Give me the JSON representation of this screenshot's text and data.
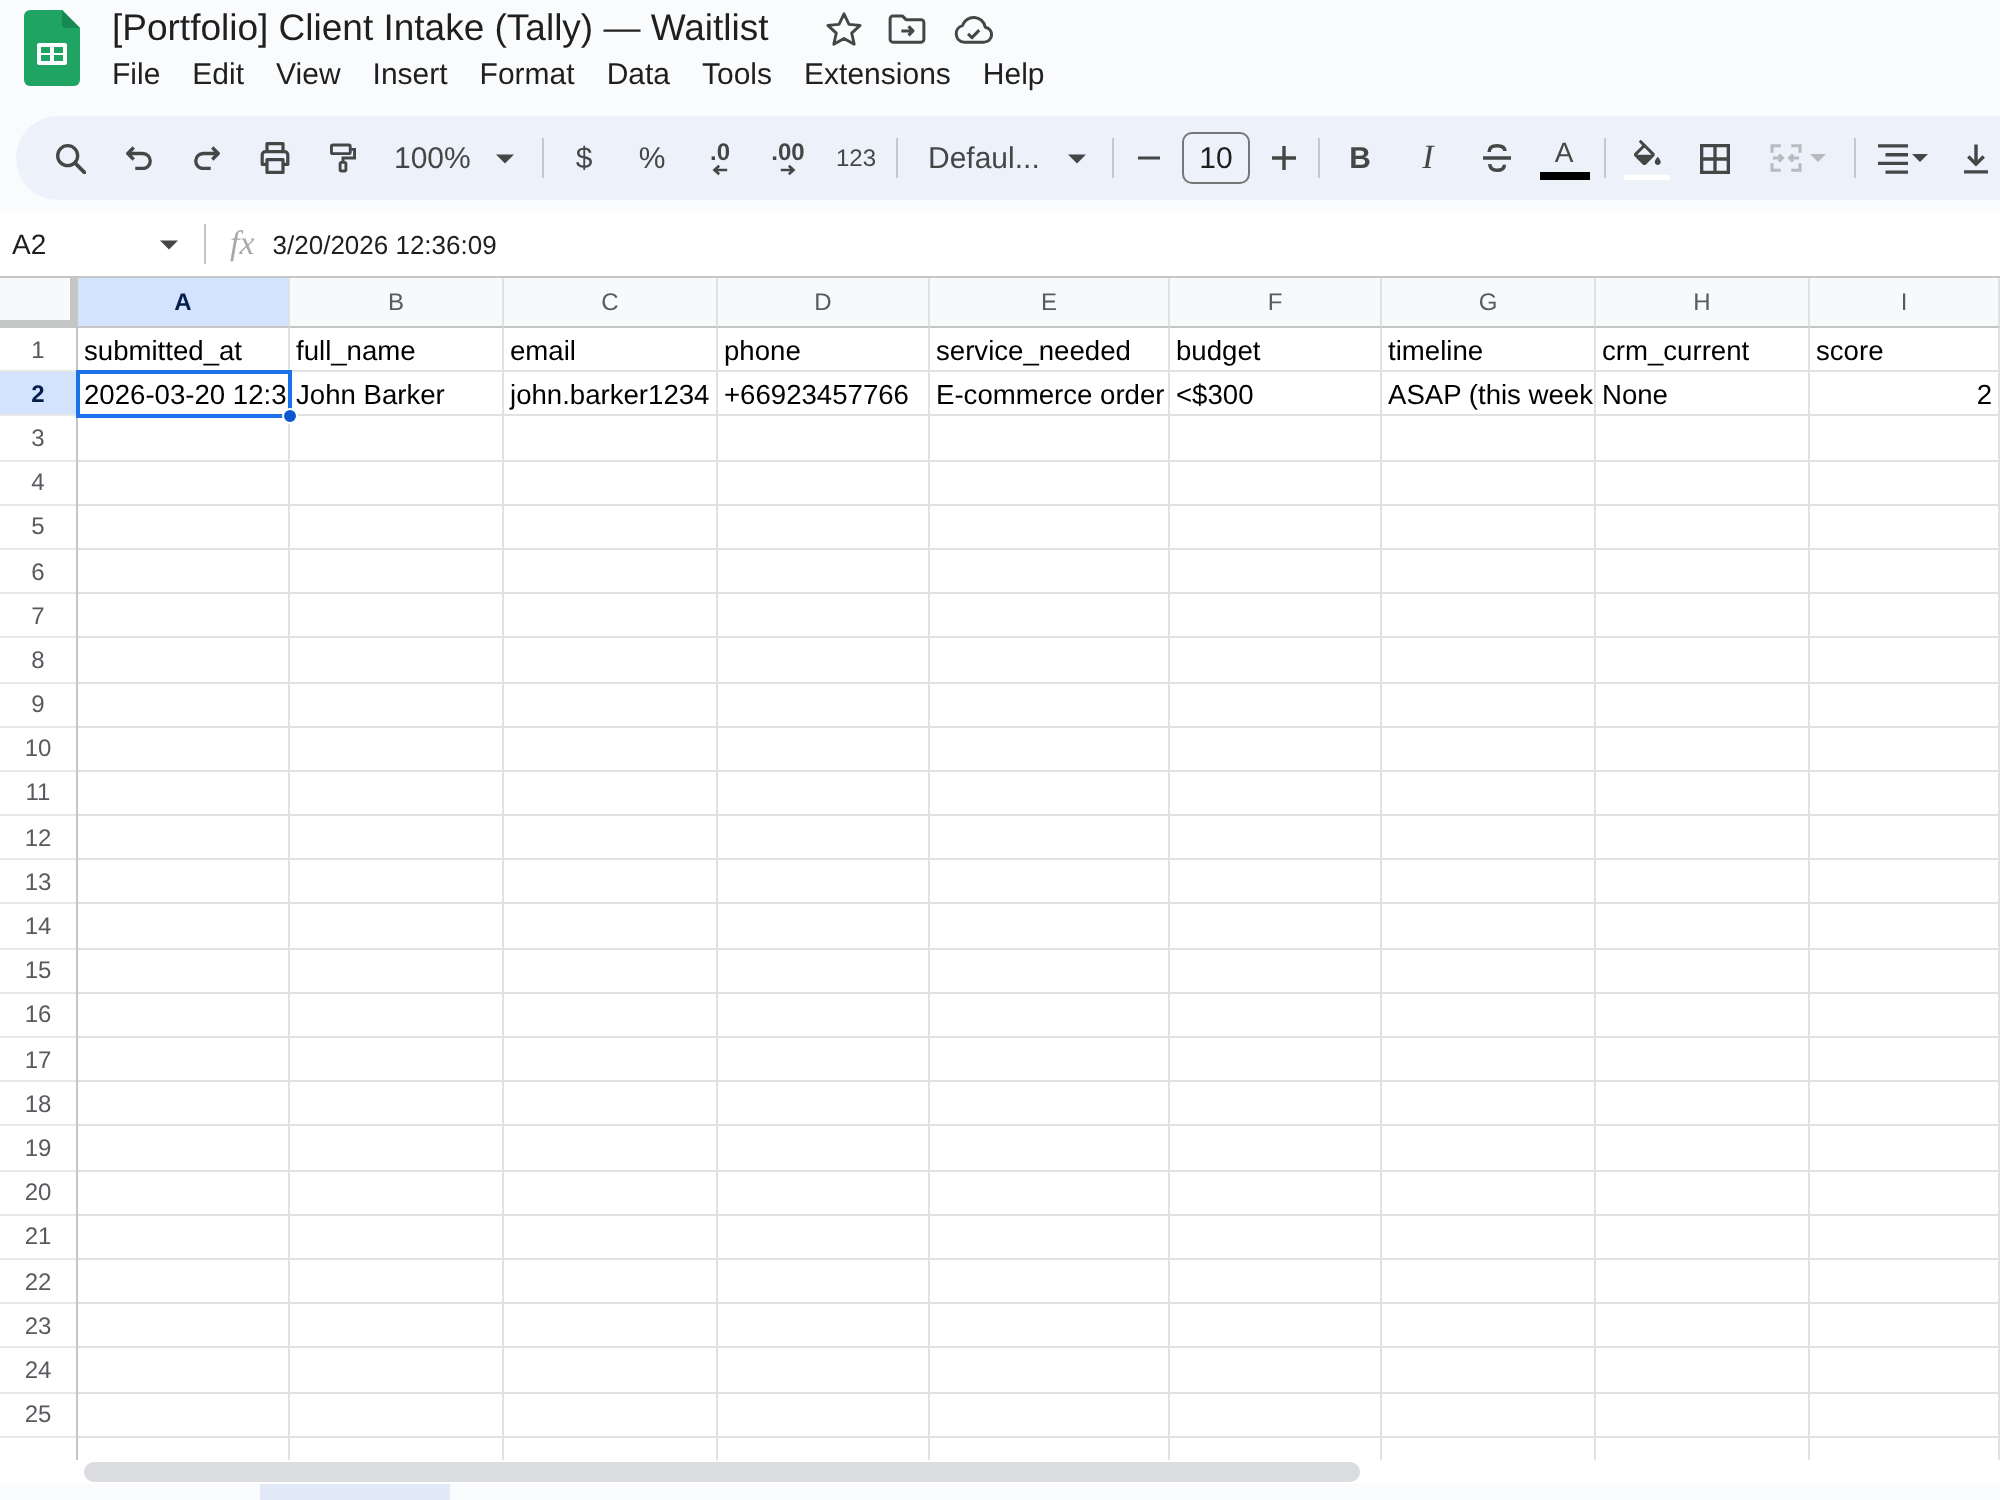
{
  "document": {
    "title": "[Portfolio] Client Intake (Tally) — Waitlist"
  },
  "menu": [
    "File",
    "Edit",
    "View",
    "Insert",
    "Format",
    "Data",
    "Tools",
    "Extensions",
    "Help"
  ],
  "toolbar": {
    "zoom": "100%",
    "currency": "$",
    "percent": "%",
    "decrease_decimal": ".0",
    "increase_decimal": ".00",
    "number_format": "123",
    "font": "Defaul...",
    "font_size": "10",
    "bold": "B",
    "italic": "I",
    "text_color": "A",
    "merge_cells": {
      "disabled": true
    }
  },
  "formula_bar": {
    "name_box": "A2",
    "function_label": "fx",
    "value": "3/20/2026 12:36:09"
  },
  "grid": {
    "columns": [
      {
        "label": "A",
        "selected": true
      },
      {
        "label": "B",
        "selected": false
      },
      {
        "label": "C",
        "selected": false
      },
      {
        "label": "D",
        "selected": false
      },
      {
        "label": "E",
        "selected": false
      },
      {
        "label": "F",
        "selected": false
      },
      {
        "label": "G",
        "selected": false
      },
      {
        "label": "H",
        "selected": false
      },
      {
        "label": "I",
        "selected": false
      }
    ],
    "rows": [
      {
        "number": "1",
        "selected": false,
        "cells": [
          {
            "kind": "text",
            "text": "submitted_at",
            "selected": false
          },
          {
            "kind": "text",
            "text": "full_name",
            "selected": false
          },
          {
            "kind": "text",
            "text": "email",
            "selected": false
          },
          {
            "kind": "text",
            "text": "phone",
            "selected": false
          },
          {
            "kind": "text",
            "text": "service_needed",
            "selected": false
          },
          {
            "kind": "text",
            "text": "budget",
            "selected": false
          },
          {
            "kind": "text",
            "text": "timeline",
            "selected": false
          },
          {
            "kind": "text",
            "text": "crm_current",
            "selected": false
          },
          {
            "kind": "text",
            "text": "score",
            "selected": false
          }
        ]
      },
      {
        "number": "2",
        "selected": true,
        "cells": [
          {
            "kind": "text",
            "text": "2026-03-20 12:3",
            "selected": true
          },
          {
            "kind": "text",
            "text": "John Barker",
            "selected": false
          },
          {
            "kind": "text",
            "text": "john.barker1234",
            "selected": false
          },
          {
            "kind": "text",
            "text": "+66923457766",
            "selected": false
          },
          {
            "kind": "text",
            "text": "E-commerce order",
            "selected": false
          },
          {
            "kind": "text",
            "text": "<$300",
            "selected": false
          },
          {
            "kind": "text",
            "text": "ASAP (this week",
            "selected": false
          },
          {
            "kind": "text",
            "text": "None",
            "selected": false
          },
          {
            "kind": "number",
            "text": "2",
            "selected": false
          }
        ]
      },
      {
        "number": "3",
        "selected": false
      },
      {
        "number": "4",
        "selected": false
      },
      {
        "number": "5",
        "selected": false
      },
      {
        "number": "6",
        "selected": false
      },
      {
        "number": "7",
        "selected": false
      },
      {
        "number": "8",
        "selected": false
      },
      {
        "number": "9",
        "selected": false
      },
      {
        "number": "10",
        "selected": false
      },
      {
        "number": "11",
        "selected": false
      },
      {
        "number": "12",
        "selected": false
      },
      {
        "number": "13",
        "selected": false
      },
      {
        "number": "14",
        "selected": false
      },
      {
        "number": "15",
        "selected": false
      },
      {
        "number": "16",
        "selected": false
      },
      {
        "number": "17",
        "selected": false
      },
      {
        "number": "18",
        "selected": false
      },
      {
        "number": "19",
        "selected": false
      },
      {
        "number": "20",
        "selected": false
      },
      {
        "number": "21",
        "selected": false
      },
      {
        "number": "22",
        "selected": false
      },
      {
        "number": "23",
        "selected": false
      },
      {
        "number": "24",
        "selected": false
      },
      {
        "number": "25",
        "selected": false
      }
    ]
  }
}
